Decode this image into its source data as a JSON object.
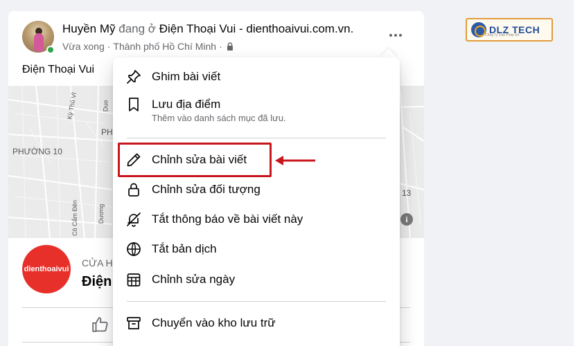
{
  "post": {
    "author": "Huyền Mỹ",
    "verb": "đang ở",
    "place_link": "Điện Thoại Vui - dienthoaivui.com.vn.",
    "time": "Vừa xong",
    "separator": "·",
    "location": "Thành phố Hồ Chí Minh",
    "text": "Điện Thoại Vui",
    "privacy_icon": "lock-icon",
    "more_icon": "more-options-icon"
  },
  "map": {
    "labels": [
      "PHƯỜNG 10",
      "PH",
      "13",
      "Duo",
      "Kỳ Thủ Vĩ",
      "Cô Cẩm Đên",
      "Dương"
    ]
  },
  "place": {
    "logo_text": "dienthoaivui",
    "category": "CỬA H",
    "name": "Điện",
    "logo_color": "#e8302b"
  },
  "brand": {
    "name": "DLZ TECH",
    "tagline": "Công Ty Giải Pháp Số",
    "accent": "#e39b3c"
  },
  "menu": {
    "items": [
      {
        "label": "Ghim bài viết",
        "icon": "pin-icon"
      },
      {
        "label": "Lưu địa điểm",
        "desc": "Thêm vào danh sách mục đã lưu.",
        "icon": "bookmark-icon"
      },
      {
        "label": "Chỉnh sửa bài viết",
        "icon": "pencil-icon"
      },
      {
        "label": "Chỉnh sửa đối tượng",
        "icon": "lock-icon"
      },
      {
        "label": "Tắt thông báo về bài viết này",
        "icon": "bell-off-icon"
      },
      {
        "label": "Tắt bản dịch",
        "icon": "globe-icon"
      },
      {
        "label": "Chỉnh sửa ngày",
        "icon": "calendar-icon"
      },
      {
        "label": "Chuyển vào kho lưu trữ",
        "icon": "archive-icon"
      }
    ]
  },
  "annotation": {
    "highlight_color": "#c8161d",
    "target": "Chỉnh sửa bài viết"
  }
}
